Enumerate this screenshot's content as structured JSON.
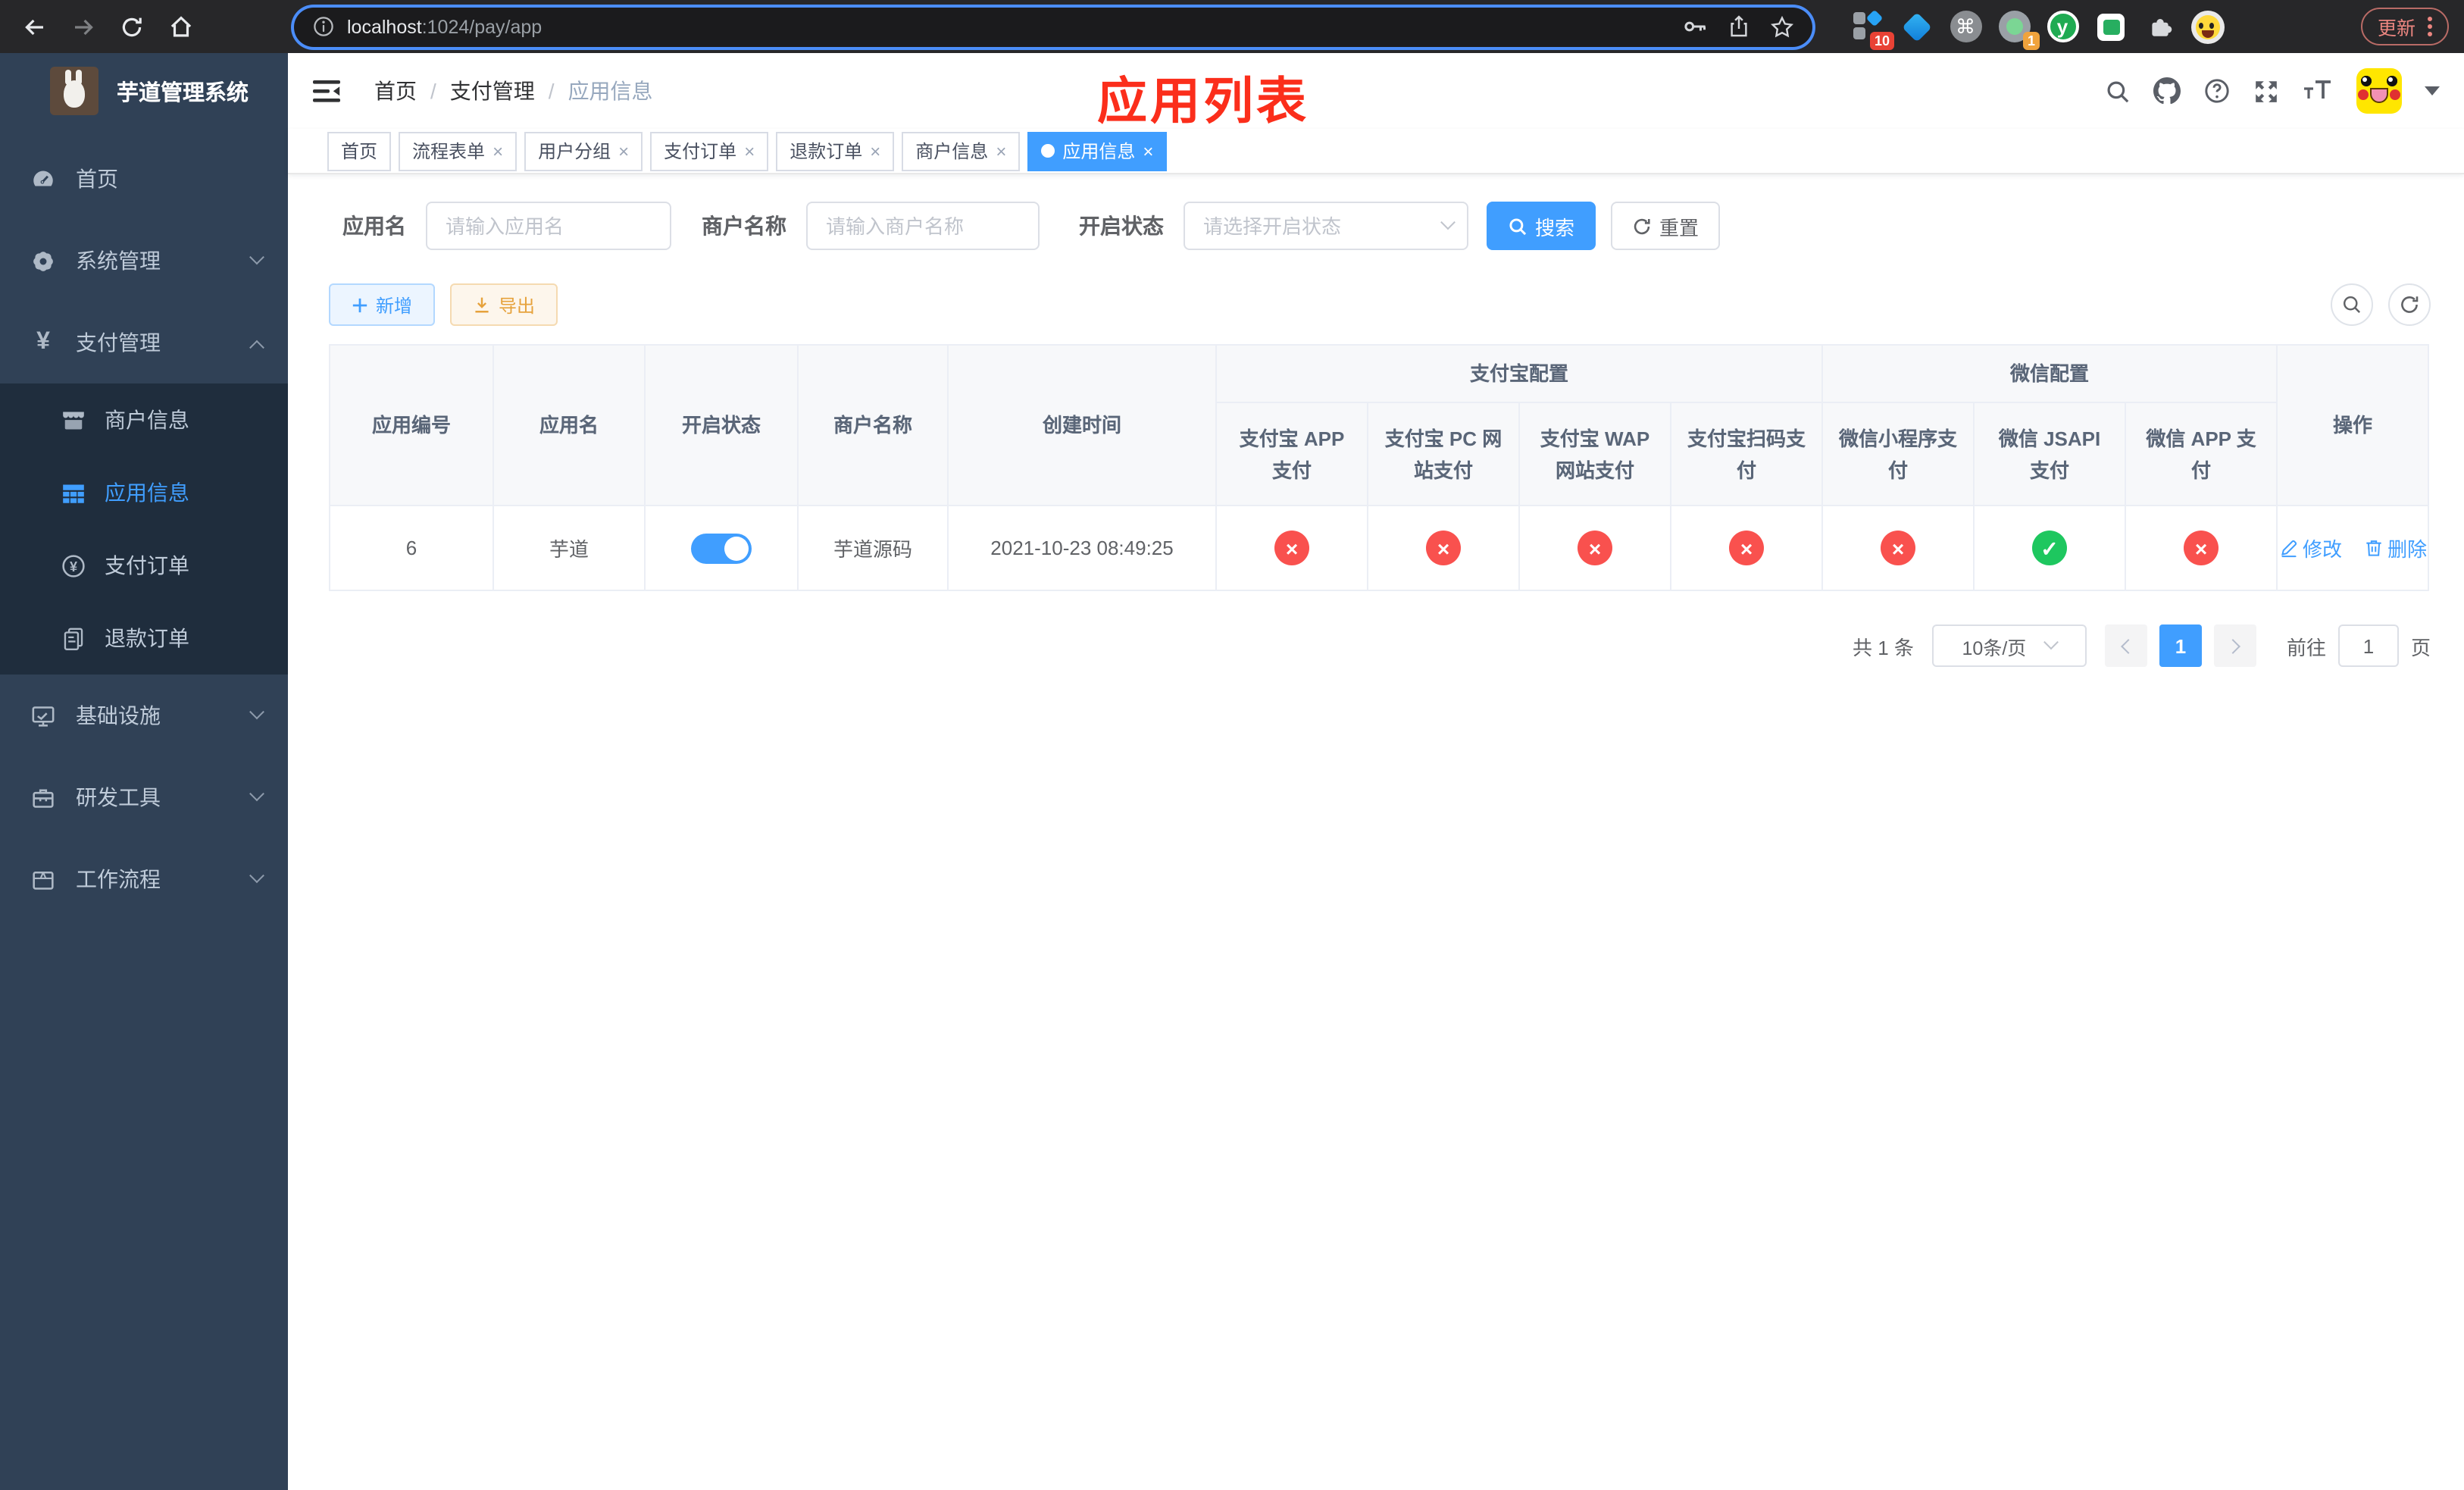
{
  "browser": {
    "url_host": "localhost",
    "url_rest": ":1024/pay/app",
    "update_label": "更新",
    "ext_badge_a": "10",
    "ext_badge_b": "1",
    "cmd_glyph": "⌘",
    "y_glyph": "y"
  },
  "sidebar": {
    "title": "芋道管理系统",
    "menu": [
      {
        "label": "首页",
        "icon": "dashboard-icon",
        "expandable": false
      },
      {
        "label": "系统管理",
        "icon": "gear-icon",
        "expandable": true,
        "expanded": false
      },
      {
        "label": "支付管理",
        "icon": "yen-icon",
        "expandable": true,
        "expanded": true,
        "children": [
          {
            "label": "商户信息",
            "icon": "shop-icon",
            "active": false
          },
          {
            "label": "应用信息",
            "icon": "grid-icon",
            "active": true
          },
          {
            "label": "支付订单",
            "icon": "yen-circle-icon",
            "active": false
          },
          {
            "label": "退款订单",
            "icon": "document-icon",
            "active": false
          }
        ]
      },
      {
        "label": "基础设施",
        "icon": "monitor-icon",
        "expandable": true,
        "expanded": false
      },
      {
        "label": "研发工具",
        "icon": "toolbox-icon",
        "expandable": true,
        "expanded": false
      },
      {
        "label": "工作流程",
        "icon": "workflow-icon",
        "expandable": true,
        "expanded": false
      }
    ]
  },
  "navbar": {
    "breadcrumb": [
      "首页",
      "支付管理",
      "应用信息"
    ],
    "annotation": "应用列表"
  },
  "tags": [
    {
      "label": "首页",
      "closable": false,
      "active": false
    },
    {
      "label": "流程表单",
      "closable": true,
      "active": false
    },
    {
      "label": "用户分组",
      "closable": true,
      "active": false
    },
    {
      "label": "支付订单",
      "closable": true,
      "active": false
    },
    {
      "label": "退款订单",
      "closable": true,
      "active": false
    },
    {
      "label": "商户信息",
      "closable": true,
      "active": false
    },
    {
      "label": "应用信息",
      "closable": true,
      "active": true
    }
  ],
  "filters": {
    "app_name_label": "应用名",
    "app_name_placeholder": "请输入应用名",
    "merchant_label": "商户名称",
    "merchant_placeholder": "请输入商户名称",
    "status_label": "开启状态",
    "status_placeholder": "请选择开启状态",
    "search_label": "搜索",
    "reset_label": "重置"
  },
  "toolbar": {
    "add_label": "新增",
    "export_label": "导出"
  },
  "table": {
    "simple_headers": [
      "应用编号",
      "应用名",
      "开启状态",
      "商户名称",
      "创建时间"
    ],
    "groups": [
      {
        "label": "支付宝配置",
        "children": [
          "支付宝 APP 支付",
          "支付宝 PC 网站支付",
          "支付宝 WAP 网站支付",
          "支付宝扫码支付"
        ]
      },
      {
        "label": "微信配置",
        "children": [
          "微信小程序支付",
          "微信 JSAPI 支付",
          "微信 APP 支付"
        ]
      }
    ],
    "action_header": "操作",
    "row": {
      "id": "6",
      "name": "芋道",
      "enabled": true,
      "merchant": "芋道源码",
      "created": "2021-10-23 08:49:25",
      "pay_status": [
        false,
        false,
        false,
        false,
        false,
        true,
        false
      ],
      "actions": [
        {
          "label": "修改",
          "icon": "edit-icon"
        },
        {
          "label": "删除",
          "icon": "delete-icon"
        }
      ]
    }
  },
  "pagination": {
    "total": "共 1 条",
    "page_size": "10条/页",
    "current_page": "1",
    "goto_label": "前往",
    "goto_value": "1",
    "page_suffix": "页"
  },
  "colors": {
    "primary": "#409eff",
    "danger": "#f9514e",
    "success": "#1ec75f",
    "warning": "#e6a23c"
  }
}
